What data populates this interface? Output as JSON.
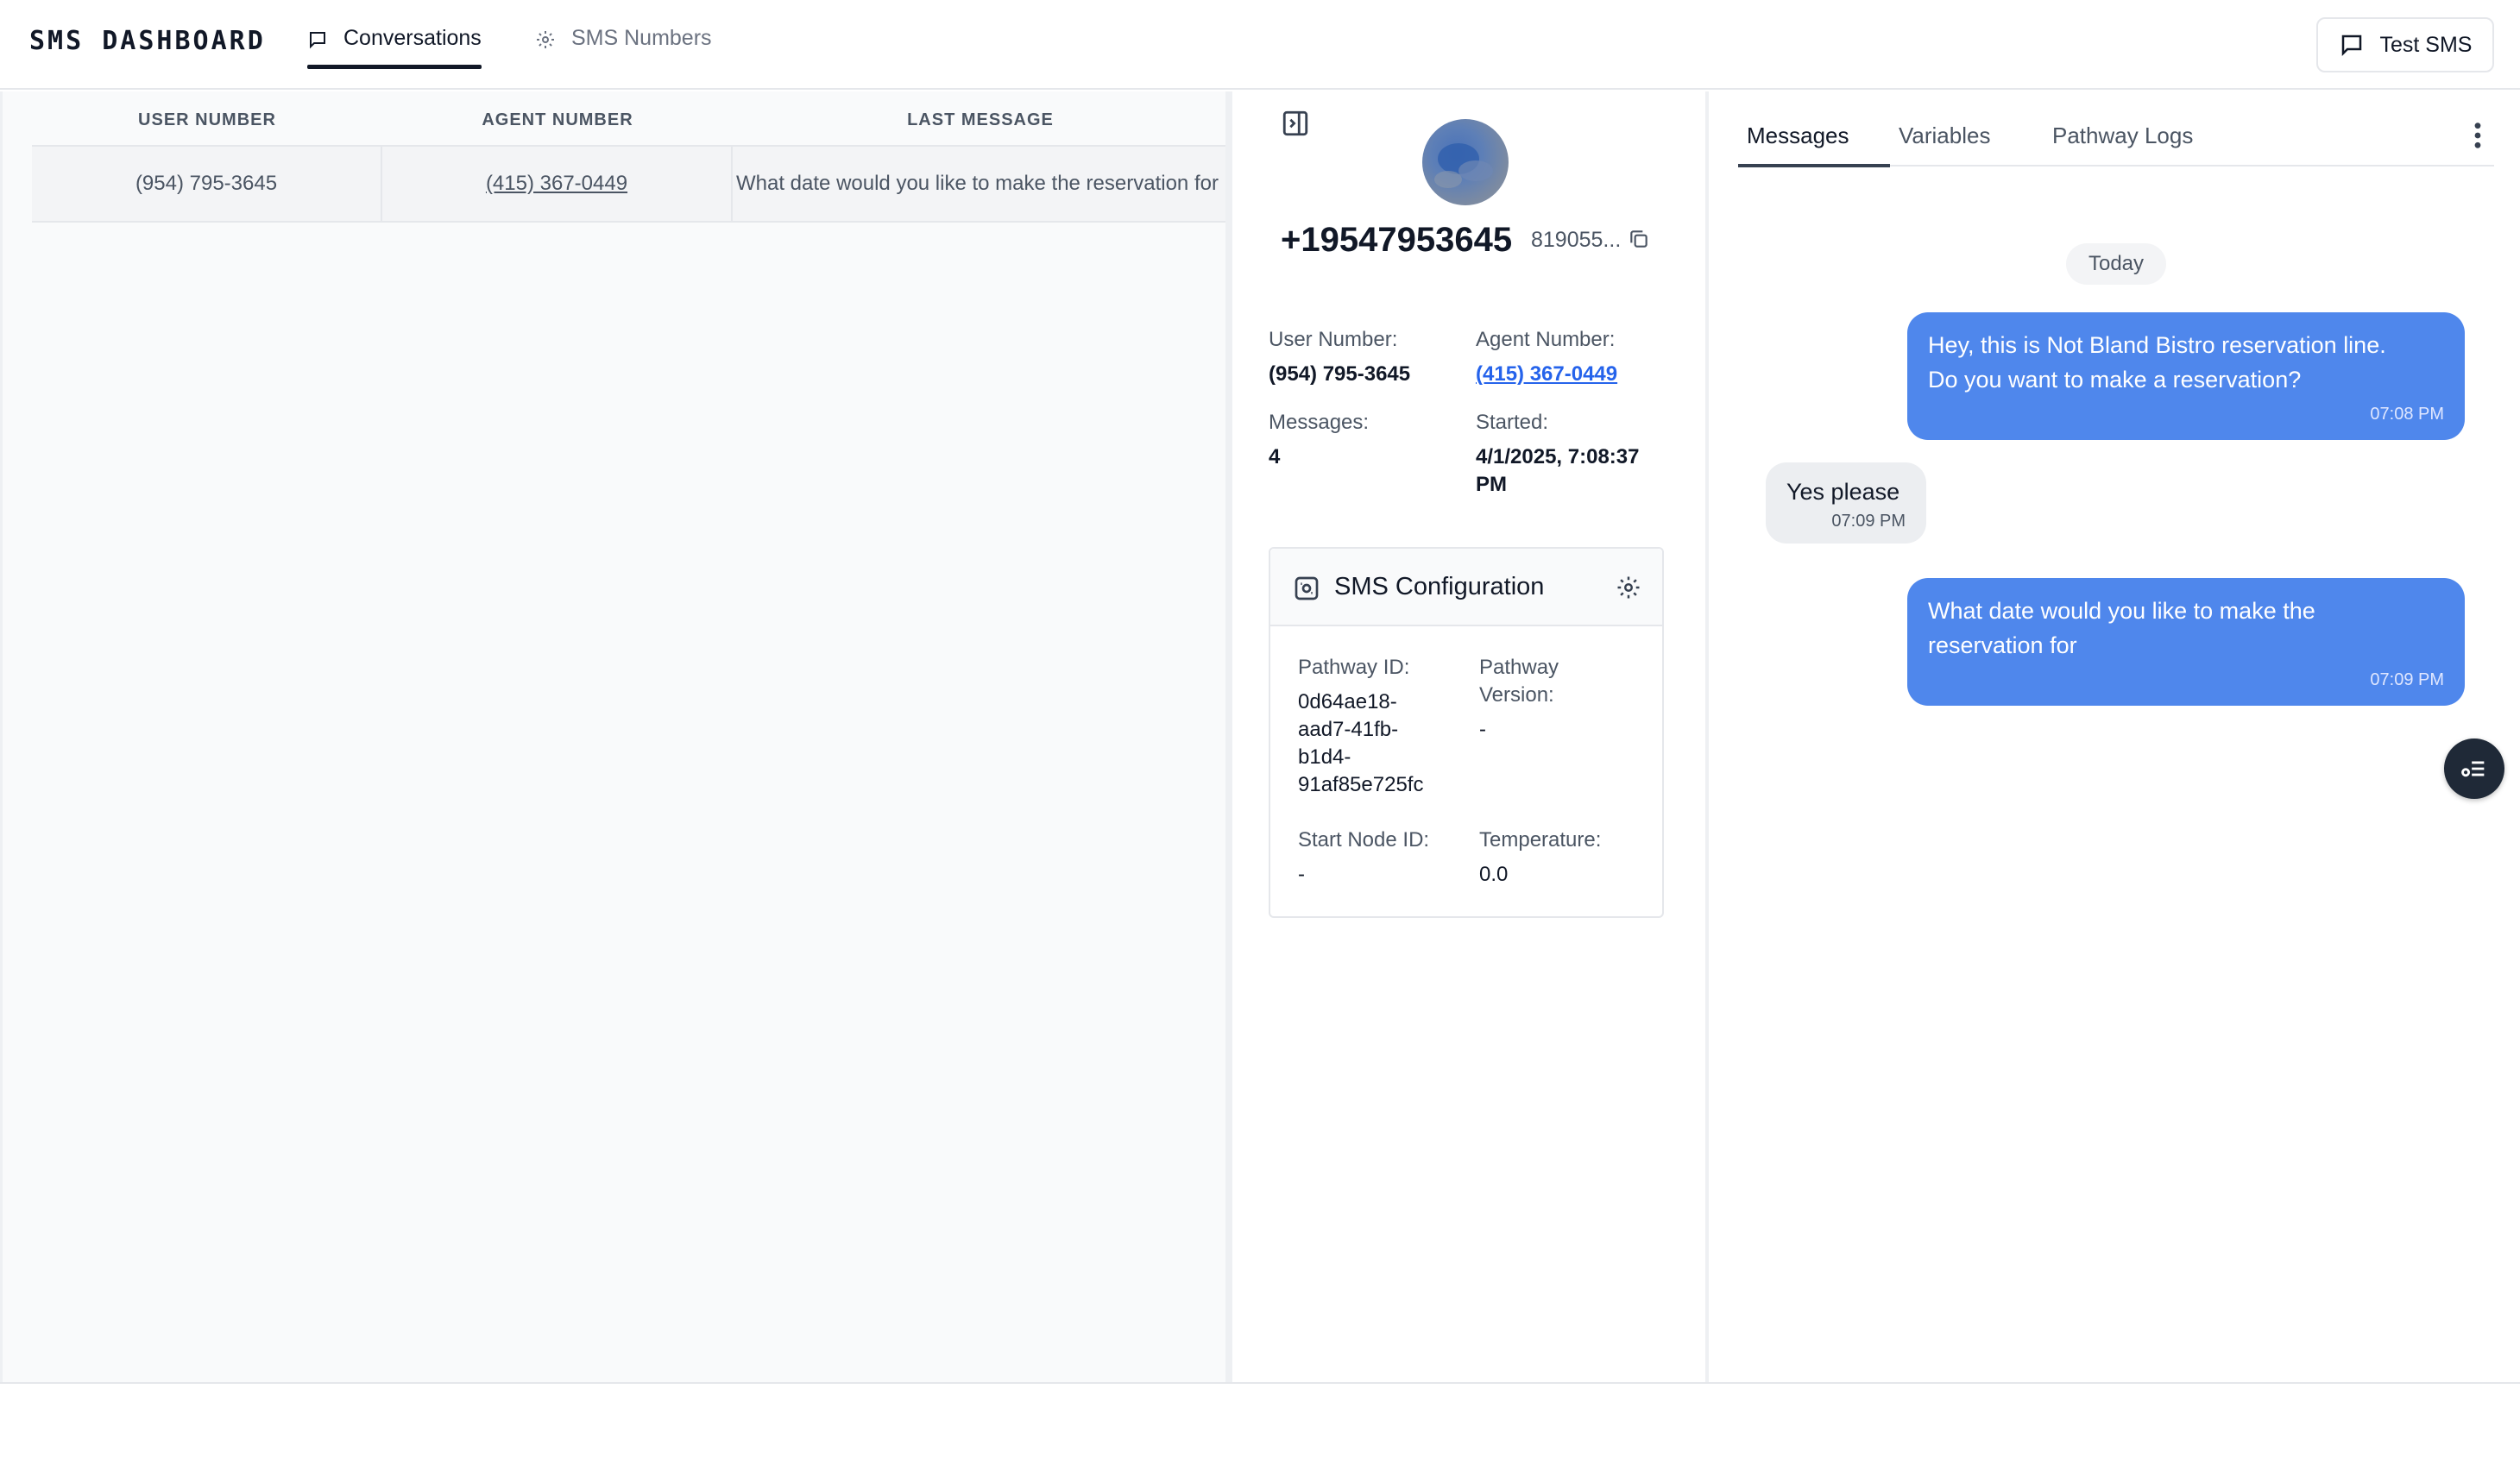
{
  "app": {
    "brand": "SMS DASHBOARD",
    "test_button": "Test SMS"
  },
  "nav": {
    "tabs": [
      {
        "label": "Conversations"
      },
      {
        "label": "SMS Numbers"
      }
    ]
  },
  "table": {
    "headers": [
      "USER NUMBER",
      "AGENT NUMBER",
      "LAST MESSAGE"
    ],
    "rows": [
      {
        "user_number": "(954) 795-3645",
        "agent_number": "(415) 367-0449",
        "last_message": "What date would you like to make the reservation for"
      }
    ]
  },
  "details": {
    "phone": "+19547953645",
    "call_id": "819055...",
    "user_number_label": "User Number:",
    "user_number": "(954) 795-3645",
    "agent_number_label": "Agent Number:",
    "agent_number": "(415) 367-0449",
    "messages_label": "Messages:",
    "messages": "4",
    "started_label": "Started:",
    "started_line1": "4/1/2025, 7:08:37",
    "started_line2": "PM"
  },
  "sms_config": {
    "title": "SMS Configuration",
    "pathway_id_label": "Pathway ID:",
    "pathway_id_lines": [
      "0d64ae18-",
      "aad7-41fb-",
      "b1d4-",
      "91af85e725fc"
    ],
    "pathway_version_label_lines": [
      "Pathway",
      "Version:"
    ],
    "pathway_version": "-",
    "start_node_label": "Start Node ID:",
    "start_node": "-",
    "temperature_label": "Temperature:",
    "temperature": "0.0"
  },
  "messages_panel": {
    "tabs": [
      "Messages",
      "Variables",
      "Pathway Logs"
    ],
    "date_divider": "Today",
    "messages": [
      {
        "direction": "outbound",
        "lines": [
          "Hey, this is Not Bland Bistro reservation line.",
          "Do you want to make a reservation?"
        ],
        "time": "07:08 PM"
      },
      {
        "direction": "inbound",
        "lines": [
          "Yes please"
        ],
        "time": "07:09 PM"
      },
      {
        "direction": "outbound",
        "lines": [
          "What date would you like to make the",
          "reservation for"
        ],
        "time": "07:09 PM"
      }
    ]
  },
  "colors": {
    "accent": "#4f87ec",
    "link": "#2563eb",
    "dark": "#111827"
  },
  "icons": [
    "chat-bubble-icon",
    "gear-icon",
    "sidebar-collapse-icon",
    "copy-icon",
    "sms-config-icon",
    "kebab-menu-icon",
    "list-fab-icon"
  ]
}
